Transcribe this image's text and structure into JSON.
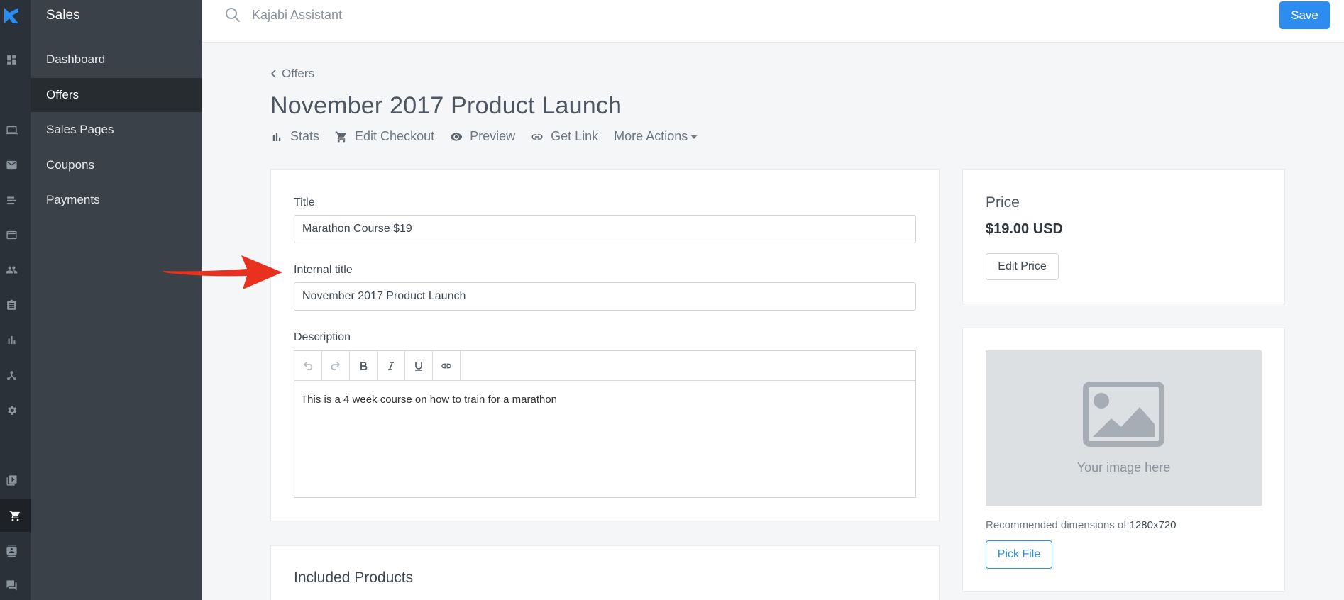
{
  "colors": {
    "accent": "#2d8cf0",
    "rail_bg": "#2b3138",
    "sidebar_bg": "#3a4148",
    "annotation_arrow": "#e8321f"
  },
  "rail": {
    "icons": [
      "kajabi-logo",
      "dashboard-icon",
      "laptop-icon",
      "mail-icon",
      "list-icon",
      "card-icon",
      "people-icon",
      "clipboard-icon",
      "bar-chart-icon",
      "network-icon",
      "gear-icon",
      "video-library-icon",
      "cart-icon",
      "contacts-icon",
      "chat-icon"
    ],
    "active": "cart-icon"
  },
  "sidebar": {
    "title": "Sales",
    "items": [
      {
        "label": "Dashboard"
      },
      {
        "label": "Offers",
        "active": true
      },
      {
        "label": "Sales Pages"
      },
      {
        "label": "Coupons"
      },
      {
        "label": "Payments"
      }
    ]
  },
  "topbar": {
    "search_placeholder": "Kajabi Assistant",
    "save_label": "Save"
  },
  "breadcrumb": {
    "label": "Offers"
  },
  "page": {
    "title": "November 2017 Product Launch"
  },
  "actions": [
    {
      "label": "Stats",
      "icon": "bar-chart-icon"
    },
    {
      "label": "Edit Checkout",
      "icon": "cart-icon"
    },
    {
      "label": "Preview",
      "icon": "eye-icon"
    },
    {
      "label": "Get Link",
      "icon": "link-icon"
    },
    {
      "label": "More Actions",
      "icon": "caret-down-icon"
    }
  ],
  "form": {
    "title_label": "Title",
    "title_value": "Marathon Course $19",
    "internal_title_label": "Internal title",
    "internal_title_value": "November 2017 Product Launch",
    "description_label": "Description",
    "description_value": "This is a 4 week course on how to train for a marathon",
    "editor_tools": [
      "undo-icon",
      "redo-icon",
      "bold-icon",
      "italic-icon",
      "underline-icon",
      "link-icon"
    ]
  },
  "price": {
    "title": "Price",
    "value": "$19.00 USD",
    "edit_label": "Edit Price"
  },
  "image": {
    "placeholder_text": "Your image here",
    "recommended_prefix": "Recommended dimensions of ",
    "recommended_value": "1280x720",
    "pick_label": "Pick File"
  },
  "included": {
    "title": "Included Products"
  }
}
